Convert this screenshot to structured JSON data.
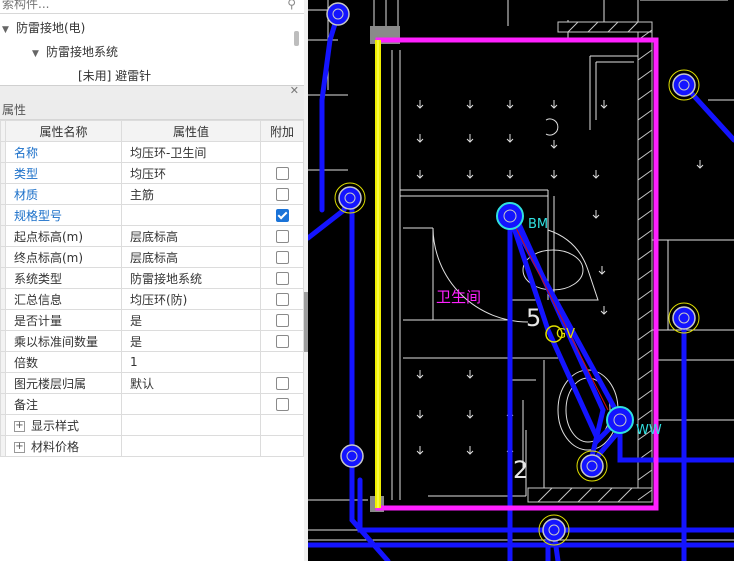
{
  "search": {
    "placeholder": "索构件..."
  },
  "tree": {
    "items": [
      {
        "label": "防雷接地(电)"
      },
      {
        "label": "防雷接地系统"
      },
      {
        "label": "[未用] 避雷针"
      }
    ]
  },
  "panel": {
    "title": "属性"
  },
  "table": {
    "headers": {
      "name": "属性名称",
      "value": "属性值",
      "extra": "附加"
    },
    "rows": [
      {
        "idx": "",
        "name": "名称",
        "value": "均压环-卫生间",
        "has_check": false,
        "checked": false,
        "blue": true
      },
      {
        "idx": "",
        "name": "类型",
        "value": "均压环",
        "has_check": true,
        "checked": false,
        "blue": true
      },
      {
        "idx": "",
        "name": "材质",
        "value": "主筋",
        "has_check": true,
        "checked": false,
        "blue": true
      },
      {
        "idx": "",
        "name": "规格型号",
        "value": "",
        "has_check": true,
        "checked": true,
        "blue": true
      },
      {
        "idx": "",
        "name": "起点标高(m)",
        "value": "层底标高",
        "has_check": true,
        "checked": false,
        "blue": false
      },
      {
        "idx": "",
        "name": "终点标高(m)",
        "value": "层底标高",
        "has_check": true,
        "checked": false,
        "blue": false
      },
      {
        "idx": "",
        "name": "系统类型",
        "value": "防雷接地系统",
        "has_check": true,
        "checked": false,
        "blue": false
      },
      {
        "idx": "",
        "name": "汇总信息",
        "value": "均压环(防)",
        "has_check": true,
        "checked": false,
        "blue": false
      },
      {
        "idx": "",
        "name": "是否计量",
        "value": "是",
        "has_check": true,
        "checked": false,
        "blue": false
      },
      {
        "idx": "",
        "name": "乘以标准间数量",
        "value": "是",
        "has_check": true,
        "checked": false,
        "blue": false
      },
      {
        "idx": "",
        "name": "倍数",
        "value": "1",
        "has_check": false,
        "checked": false,
        "blue": false
      },
      {
        "idx": "",
        "name": "图元楼层归属",
        "value": "默认",
        "has_check": true,
        "checked": false,
        "blue": false
      },
      {
        "idx": "",
        "name": "备注",
        "value": "",
        "has_check": true,
        "checked": false,
        "blue": false
      },
      {
        "idx": "",
        "name": "显示样式",
        "value": "",
        "has_check": false,
        "checked": false,
        "blue": false,
        "expand": true
      },
      {
        "idx": "",
        "name": "材料价格",
        "value": "",
        "has_check": false,
        "checked": false,
        "blue": false,
        "expand": true
      }
    ]
  },
  "cad": {
    "labels": {
      "room": "卫生间",
      "bm": "BM",
      "num5": "5",
      "gv": "GV",
      "num2": "2",
      "ww": "WW"
    },
    "colors": {
      "wire": "#1414ff",
      "ring": "#ff20ff",
      "yellow": "#f0f000",
      "wall": "#c8c8c8",
      "lines": "#e6e6e6"
    }
  }
}
